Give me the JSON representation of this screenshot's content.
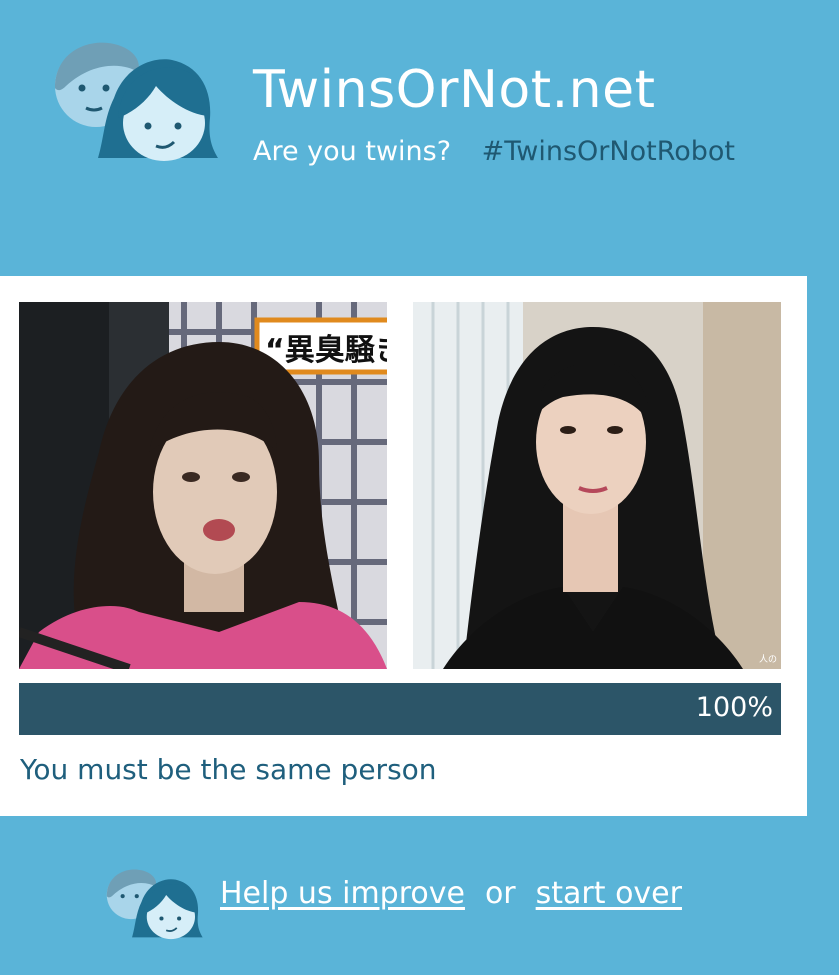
{
  "header": {
    "site_title": "TwinsOrNot.net",
    "tagline_question": "Are you twins?",
    "tagline_hashtag": "#TwinsOrNotRobot"
  },
  "result": {
    "photo_left_overlay_text": "“異臭騒き",
    "photo_right_watermark": "人の",
    "similarity_percent": 100,
    "similarity_label": "100%",
    "verdict": "You must be the same person"
  },
  "footer": {
    "help_link": "Help us improve",
    "or_text": "or",
    "start_over_link": "start over"
  },
  "colors": {
    "background": "#5ab4d8",
    "progress_bar": "#2c5568",
    "verdict_text": "#1f5f7d",
    "hashtag_text": "#1f5871"
  },
  "icons": [
    "twin-faces-logo-icon",
    "twin-faces-small-icon"
  ]
}
